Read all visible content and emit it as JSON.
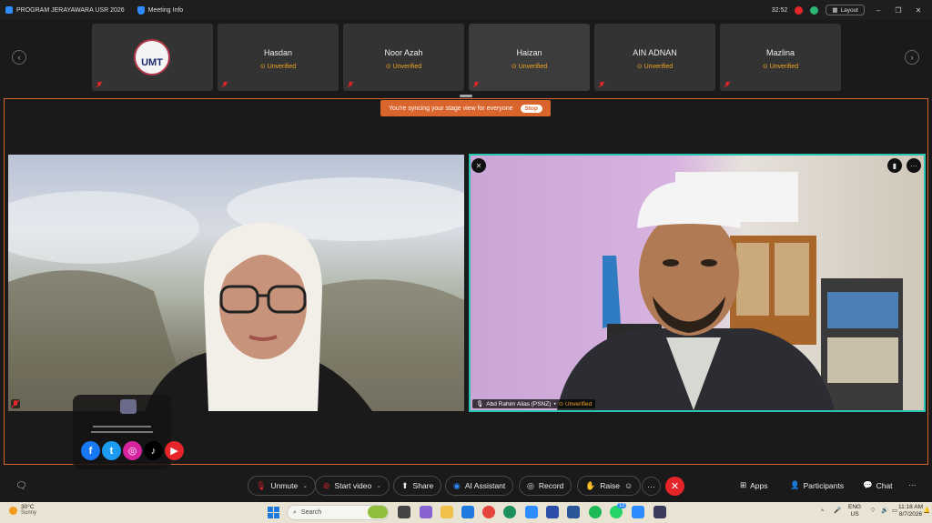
{
  "titlebar": {
    "app_name": "PROGRAM JERAYAWARA USR 2026",
    "meeting_info": "Meeting Info",
    "timer": "32:52",
    "layout_label": "Layout",
    "window_controls": [
      "–",
      "❐",
      "✕"
    ]
  },
  "gallery": {
    "tiles": [
      {
        "name": "",
        "status": "",
        "logo_text": "UMT"
      },
      {
        "name": "Hasdan",
        "status": "Unverified"
      },
      {
        "name": "Noor Azah",
        "status": "Unverified"
      },
      {
        "name": "Haizan",
        "status": "Unverified"
      },
      {
        "name": "AIN ADNAN",
        "status": "Unverified"
      },
      {
        "name": "Mazlina",
        "status": "Unverified"
      }
    ]
  },
  "stage": {
    "banner_text": "You're syncing your stage view for everyone",
    "stop_label": "Stop",
    "right_participant": {
      "name": "Abd Rahim Alias (PSNZ)",
      "status": "Unverified"
    }
  },
  "social_icons": [
    "facebook-icon",
    "twitter-icon",
    "instagram-icon",
    "tiktok-icon",
    "youtube-icon"
  ],
  "toolbar": {
    "unmute": "Unmute",
    "start_video": "Start video",
    "share": "Share",
    "ai_assistant": "AI Assistant",
    "record": "Record",
    "raise": "Raise",
    "more": "···",
    "apps": "Apps",
    "participants": "Participants",
    "chat": "Chat",
    "right_more": "···"
  },
  "taskbar": {
    "weather_temp": "30°C",
    "weather_desc": "Sunny",
    "search_placeholder": "Search",
    "lang_top": "ENG",
    "lang_bottom": "US",
    "time": "11:18 AM",
    "date": "8/7/2026",
    "badge_count": "13"
  },
  "colors": {
    "accent_orange": "#d9642c",
    "active_speaker": "#29c4b2",
    "unverified": "#f5a623",
    "end_call": "#e5252a",
    "zoom_blue": "#2d8cff"
  }
}
